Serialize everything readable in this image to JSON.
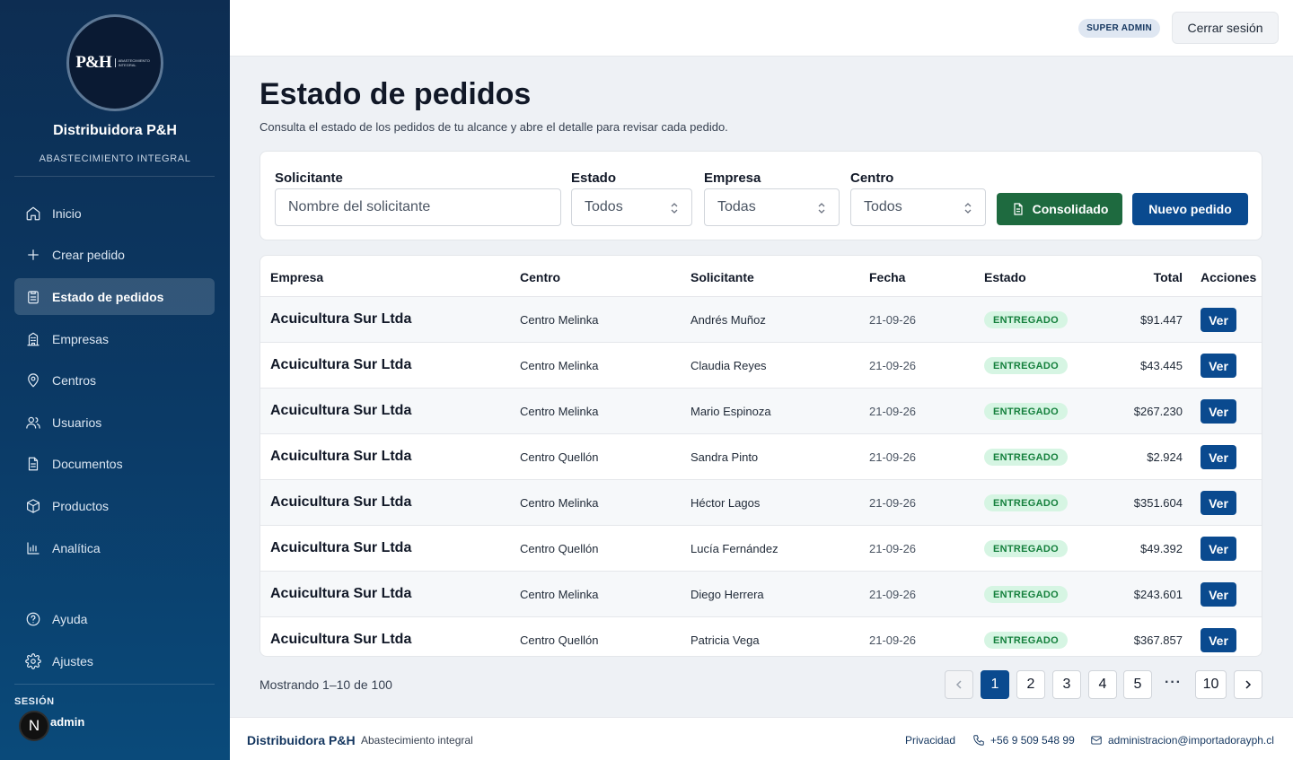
{
  "sidebar": {
    "logo_text": "P&H",
    "logo_sub": "ABASTECIMIENTO INTEGRAL",
    "brand_name": "Distribuidora P&H",
    "brand_sub": "ABASTECIMIENTO INTEGRAL",
    "nav": [
      {
        "label": "Inicio",
        "icon": "home-icon"
      },
      {
        "label": "Crear pedido",
        "icon": "plus-icon"
      },
      {
        "label": "Estado de pedidos",
        "icon": "clipboard-icon",
        "active": true
      },
      {
        "label": "Empresas",
        "icon": "building-icon"
      },
      {
        "label": "Centros",
        "icon": "map-pin-icon"
      },
      {
        "label": "Usuarios",
        "icon": "users-icon"
      },
      {
        "label": "Documentos",
        "icon": "document-icon"
      },
      {
        "label": "Productos",
        "icon": "box-icon"
      },
      {
        "label": "Analítica",
        "icon": "bar-chart-icon"
      }
    ],
    "bottom_nav": [
      {
        "label": "Ayuda",
        "icon": "help-circle-icon"
      },
      {
        "label": "Ajustes",
        "icon": "gear-icon"
      }
    ],
    "session_label": "SESIÓN",
    "session_user": "admin",
    "avatar_letter": "N"
  },
  "header": {
    "role_badge": "SUPER ADMIN",
    "logout_label": "Cerrar sesión"
  },
  "page": {
    "title": "Estado de pedidos",
    "description": "Consulta el estado de los pedidos de tu alcance y abre el detalle para revisar cada pedido."
  },
  "filters": {
    "solicitante_label": "Solicitante",
    "solicitante_placeholder": "Nombre del solicitante",
    "estado_label": "Estado",
    "estado_value": "Todos",
    "empresa_label": "Empresa",
    "empresa_value": "Todas",
    "centro_label": "Centro",
    "centro_value": "Todos",
    "consolidado_label": "Consolidado",
    "nuevo_label": "Nuevo pedido"
  },
  "table": {
    "headers": [
      "Empresa",
      "Centro",
      "Solicitante",
      "Fecha",
      "Estado",
      "Total",
      "Acciones"
    ],
    "action_label": "Ver",
    "rows": [
      {
        "empresa": "Acuicultura Sur Ltda",
        "centro": "Centro Melinka",
        "solicitante": "Andrés Muñoz",
        "fecha": "21-09-26",
        "estado": "ENTREGADO",
        "total": "$91.447"
      },
      {
        "empresa": "Acuicultura Sur Ltda",
        "centro": "Centro Melinka",
        "solicitante": "Claudia Reyes",
        "fecha": "21-09-26",
        "estado": "ENTREGADO",
        "total": "$43.445"
      },
      {
        "empresa": "Acuicultura Sur Ltda",
        "centro": "Centro Melinka",
        "solicitante": "Mario Espinoza",
        "fecha": "21-09-26",
        "estado": "ENTREGADO",
        "total": "$267.230"
      },
      {
        "empresa": "Acuicultura Sur Ltda",
        "centro": "Centro Quellón",
        "solicitante": "Sandra Pinto",
        "fecha": "21-09-26",
        "estado": "ENTREGADO",
        "total": "$2.924"
      },
      {
        "empresa": "Acuicultura Sur Ltda",
        "centro": "Centro Melinka",
        "solicitante": "Héctor Lagos",
        "fecha": "21-09-26",
        "estado": "ENTREGADO",
        "total": "$351.604"
      },
      {
        "empresa": "Acuicultura Sur Ltda",
        "centro": "Centro Quellón",
        "solicitante": "Lucía Fernández",
        "fecha": "21-09-26",
        "estado": "ENTREGADO",
        "total": "$49.392"
      },
      {
        "empresa": "Acuicultura Sur Ltda",
        "centro": "Centro Melinka",
        "solicitante": "Diego Herrera",
        "fecha": "21-09-26",
        "estado": "ENTREGADO",
        "total": "$243.601"
      },
      {
        "empresa": "Acuicultura Sur Ltda",
        "centro": "Centro Quellón",
        "solicitante": "Patricia Vega",
        "fecha": "21-09-26",
        "estado": "ENTREGADO",
        "total": "$367.857"
      }
    ]
  },
  "pagination": {
    "showing": "Mostrando 1–10 de 100",
    "pages": [
      "1",
      "2",
      "3",
      "4",
      "5"
    ],
    "ellipsis": "···",
    "last_page": "10",
    "current": "1"
  },
  "footer": {
    "brand": "Distribuidora P&H",
    "sub": "Abastecimiento integral",
    "privacy": "Privacidad",
    "phone": "+56 9 509 548 99",
    "email": "administracion@importadorayph.cl"
  },
  "colors": {
    "sidebar_top": "#0d2d52",
    "primary": "#0a4a8f",
    "success_button": "#1e6a3f",
    "badge_bg": "#d6f5e3",
    "badge_text": "#15803d"
  }
}
